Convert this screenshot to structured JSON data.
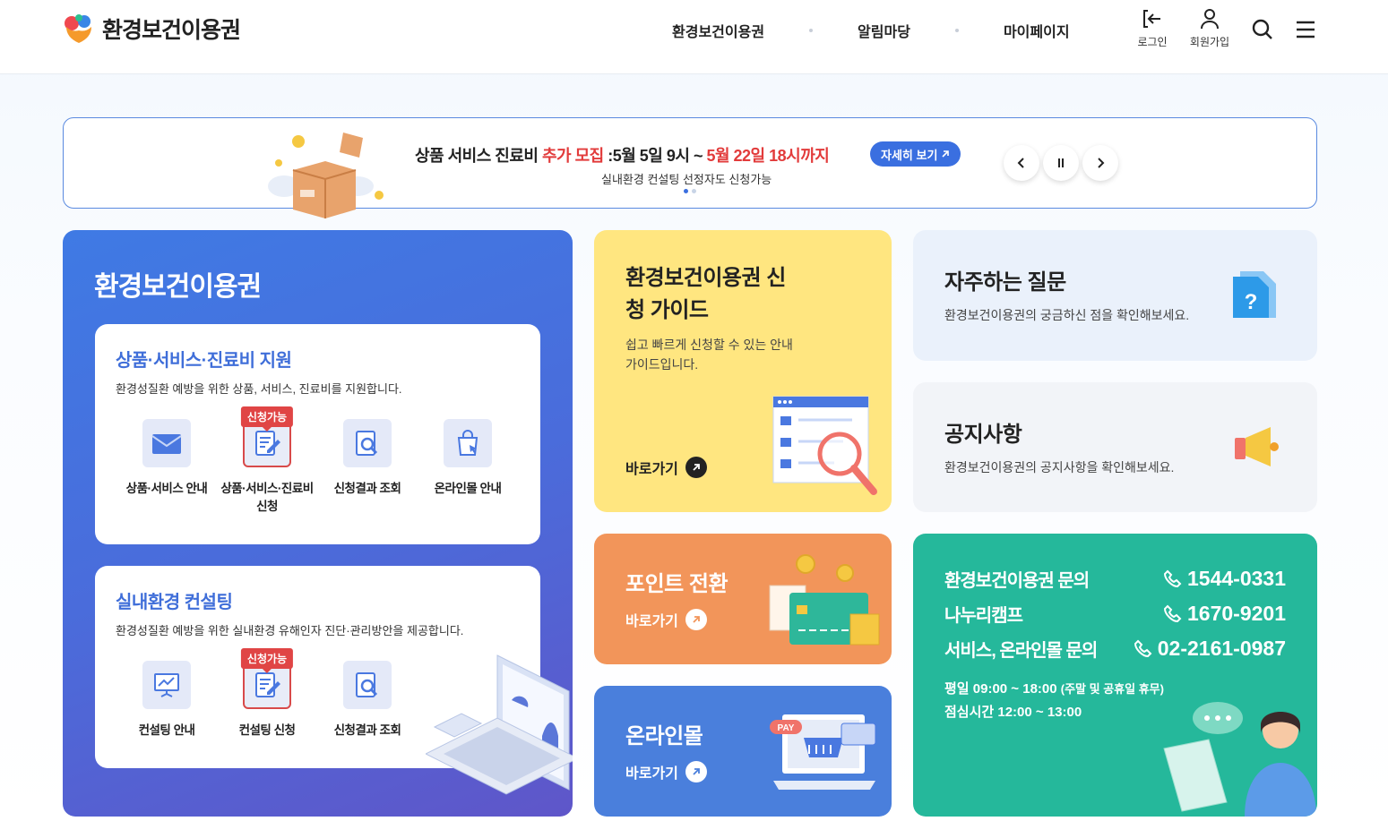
{
  "header": {
    "logo_text": "환경보건이용권",
    "nav": [
      "환경보건이용권",
      "알림마당",
      "마이페이지"
    ],
    "login_label": "로그인",
    "signup_label": "회원가입"
  },
  "banner": {
    "line1_part1": "상품 서비스 진료비 ",
    "line1_highlight1": "추가 모집",
    "line1_part2": " :5월 5일 9시 ~ ",
    "line1_highlight2": "5월 22일 18시까지",
    "detail_label": "자세히 보기",
    "line2": "실내환경 컨설팅 선정자도 신청가능",
    "slide_count": 2,
    "active_slide": 1
  },
  "main_panel": {
    "title": "환경보건이용권",
    "support": {
      "title": "상품·서비스·진료비 지원",
      "desc": "환경성질환 예방을 위한 상품, 서비스, 진료비를 지원합니다.",
      "items": [
        {
          "label": "상품·서비스 안내",
          "icon": "envelope-icon"
        },
        {
          "label": "상품·서비스·진료비 신청",
          "icon": "edit-document-icon",
          "badge": "신청가능"
        },
        {
          "label": "신청결과 조회",
          "icon": "search-document-icon"
        },
        {
          "label": "온라인몰 안내",
          "icon": "shopping-bag-icon"
        }
      ]
    },
    "consulting": {
      "title": "실내환경 컨설팅",
      "desc": "환경성질환 예방을 위한 실내환경 유해인자 진단·관리방안을 제공합니다.",
      "items": [
        {
          "label": "컨설팅 안내",
          "icon": "presentation-board-icon"
        },
        {
          "label": "컨설팅 신청",
          "icon": "edit-document-icon",
          "badge": "신청가능"
        },
        {
          "label": "신청결과 조회",
          "icon": "search-document-icon"
        }
      ]
    }
  },
  "guide": {
    "title": "환경보건이용권 신청 가이드",
    "desc": "쉽고 빠르게 신청할 수 있는 안내 가이드입니다.",
    "go_label": "바로가기"
  },
  "point": {
    "title": "포인트 전환",
    "go_label": "바로가기"
  },
  "mall": {
    "title": "온라인몰",
    "go_label": "바로가기",
    "pay_badge": "PAY"
  },
  "faq": {
    "title": "자주하는 질문",
    "desc": "환경보건이용권의 궁금하신 점을 확인해보세요."
  },
  "notice": {
    "title": "공지사항",
    "desc": "환경보건이용권의 공지사항을 확인해보세요."
  },
  "contact": {
    "rows": [
      {
        "label": "환경보건이용권 문의",
        "phone": "1544-0331"
      },
      {
        "label": "나누리캠프",
        "phone": "1670-9201"
      },
      {
        "label": "서비스, 온라인몰 문의",
        "phone": "02-2161-0987"
      }
    ],
    "hours_weekday": "평일 09:00 ~ 18:00",
    "hours_note": "(주말 및 공휴일 휴무)",
    "hours_lunch": "점심시간 12:00 ~ 13:00"
  },
  "colors": {
    "primary": "#3f6ed9",
    "accent_red": "#e23b3b",
    "yellow": "#ffe680",
    "orange": "#f2955a",
    "mall_blue": "#4a7fdc",
    "green": "#25b89b"
  }
}
